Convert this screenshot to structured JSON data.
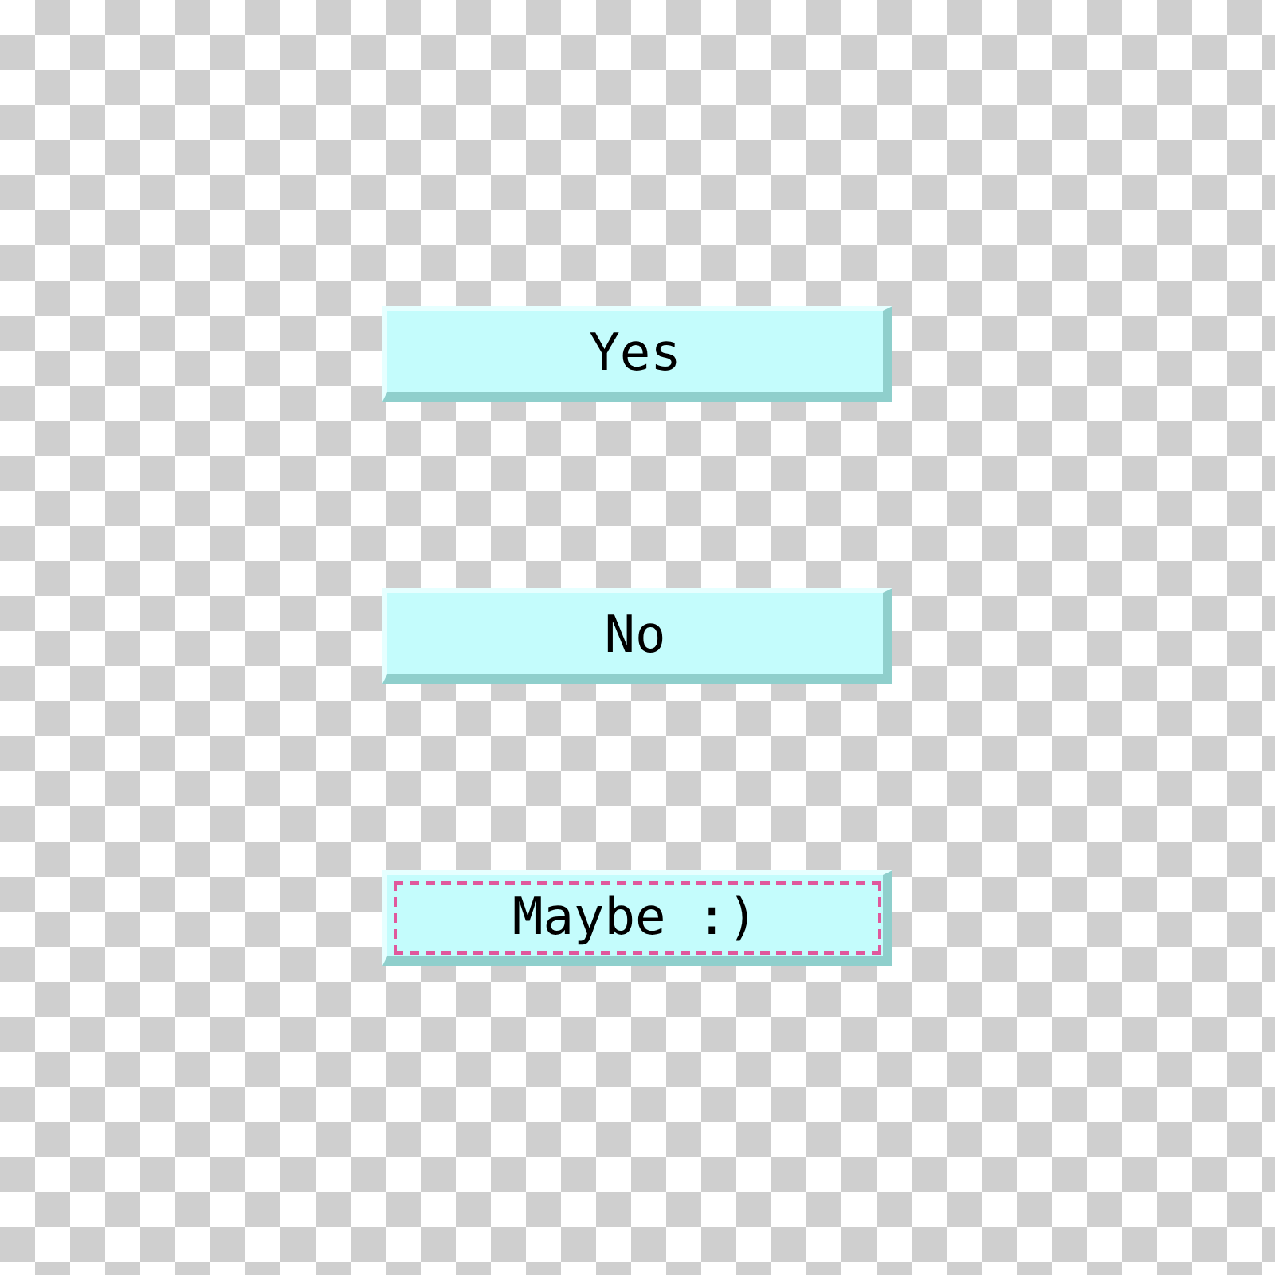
{
  "buttons": [
    {
      "label": "Yes",
      "focused": false
    },
    {
      "label": "No",
      "focused": false
    },
    {
      "label": "Maybe :)",
      "focused": true
    }
  ]
}
